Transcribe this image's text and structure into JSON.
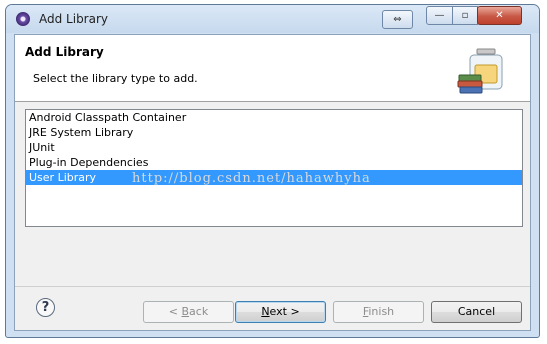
{
  "window": {
    "title": "Add Library"
  },
  "titlebar": {
    "resize_glyph": "⇔",
    "minimize_glyph": "—",
    "maximize_glyph": "▫",
    "close_glyph": "✕"
  },
  "banner": {
    "title": "Add Library",
    "description": "Select the library type to add.",
    "icon": "library-jar-books-icon"
  },
  "library_types": {
    "items": [
      {
        "label": "Android Classpath Container",
        "selected": false
      },
      {
        "label": "JRE System Library",
        "selected": false
      },
      {
        "label": "JUnit",
        "selected": false
      },
      {
        "label": "Plug-in Dependencies",
        "selected": false
      },
      {
        "label": "User Library",
        "selected": true
      }
    ]
  },
  "watermark": "http://blog.csdn.net/hahawhyha",
  "footer": {
    "help_glyph": "?",
    "back_prefix": "< ",
    "back_mnemonic": "B",
    "back_rest": "ack",
    "next_mnemonic": "N",
    "next_rest": "ext >",
    "finish_mnemonic": "F",
    "finish_rest": "inish",
    "cancel_label": "Cancel"
  },
  "colors": {
    "selection": "#3399ff",
    "titlebar": "#cfe0f2",
    "close_button": "#c75846"
  }
}
